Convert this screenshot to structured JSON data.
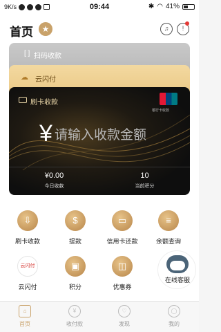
{
  "status_bar": {
    "speed": "9K/s",
    "time": "09:44",
    "battery": "41%"
  },
  "header": {
    "title": "首页"
  },
  "cards": {
    "gray_card_label": "扫码收款",
    "tan_card_label": "云闪付",
    "black_card": {
      "title": "刷卡收款",
      "unionpay_text": "银行卡收款",
      "yen_symbol": "¥",
      "amount_placeholder": "请输入收款金额",
      "today_value": "¥0.00",
      "today_label": "今日收款",
      "points_value": "10",
      "points_label": "当前积分"
    }
  },
  "grid": {
    "items": [
      {
        "label": "刷卡收款",
        "icon": "arrow-down-icon"
      },
      {
        "label": "提款",
        "icon": "money-bag-icon"
      },
      {
        "label": "信用卡还款",
        "icon": "credit-card-icon"
      },
      {
        "label": "余额查询",
        "icon": "balance-list-icon"
      },
      {
        "label": "云闪付",
        "icon": "quickpass-icon"
      },
      {
        "label": "积分",
        "icon": "gift-icon"
      },
      {
        "label": "优惠券",
        "icon": "coupon-icon"
      }
    ],
    "quickpass_icon_text": "云闪付",
    "online_service_label": "在线客服"
  },
  "tabbar": {
    "items": [
      {
        "label": "首页"
      },
      {
        "label": "收付款"
      },
      {
        "label": "发现"
      },
      {
        "label": "我的"
      }
    ]
  },
  "colors": {
    "accent": "#c9a26a",
    "dark_card": "#0e0e0e",
    "tan_card": "#e7c27d"
  }
}
